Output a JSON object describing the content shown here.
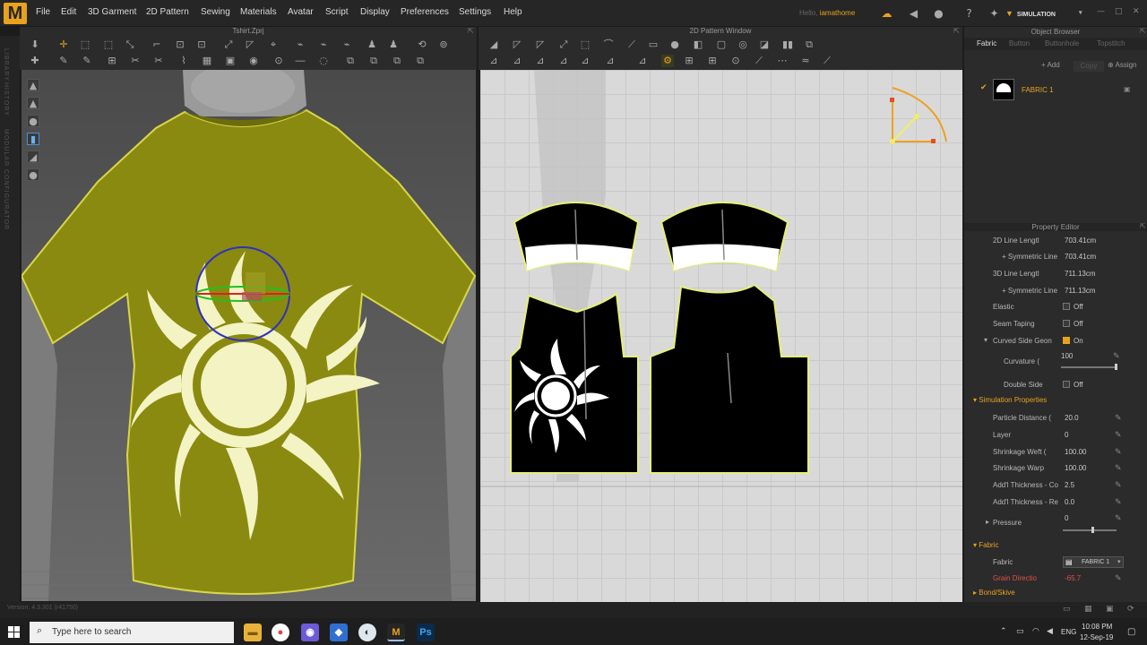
{
  "menubar": {
    "logo_text": "M",
    "items": [
      "File",
      "Edit",
      "3D Garment",
      "2D Pattern",
      "Sewing",
      "Materials",
      "Avatar",
      "Script",
      "Display",
      "Preferences",
      "Settings",
      "Help"
    ],
    "hello_label": "Hello,",
    "username": "iamathome",
    "mode": "SIMULATION"
  },
  "windows": {
    "left_title": "Tshirt.Zprj",
    "center_title": "2D Pattern Window"
  },
  "left_sidebar": {
    "tabs": [
      "LIBRARY",
      "HISTORY",
      "MODULAR CONFIGURATOR"
    ]
  },
  "object_browser": {
    "title": "Object Browser",
    "tabs": [
      "Fabric",
      "Button",
      "Buttonhole",
      "Topstitch"
    ],
    "actions": {
      "add": "+ Add",
      "copy": "Copy",
      "assign": "Assign"
    },
    "fabric_item": "FABRIC 1"
  },
  "property_editor": {
    "title": "Property Editor",
    "rows": [
      {
        "label": "2D Line Lengtl",
        "value": "703.41cm"
      },
      {
        "label": "+ Symmetric Line",
        "value": "703.41cm"
      },
      {
        "label": "3D Line Lengtl",
        "value": "711.13cm"
      },
      {
        "label": "+ Symmetric Line",
        "value": "711.13cm"
      },
      {
        "label": "Elastic",
        "value": "Off"
      },
      {
        "label": "Seam Taping",
        "value": "Off"
      },
      {
        "label": "Curved Side Geon",
        "value": "On"
      },
      {
        "label": "Curvature (",
        "value": "100"
      },
      {
        "label": "Double Side",
        "value": "Off"
      }
    ],
    "sim_section": "Simulation Properties",
    "sim_rows": [
      {
        "label": "Particle Distance (",
        "value": "20.0"
      },
      {
        "label": "Layer",
        "value": "0"
      },
      {
        "label": "Shrinkage Weft (",
        "value": "100.00"
      },
      {
        "label": "Shrinkage Warp",
        "value": "100.00"
      },
      {
        "label": "Add'l Thickness - Co",
        "value": "2.5"
      },
      {
        "label": "Add'l Thickness - Re",
        "value": "0.0"
      },
      {
        "label": "Pressure",
        "value": "0"
      }
    ],
    "fabric_section": "Fabric",
    "fabric_row": {
      "label": "Fabric",
      "value": "FABRIC 1"
    },
    "grain_row": {
      "label": "Grain Directio",
      "value": "-65.7"
    },
    "bond_section": "Bond/Skive"
  },
  "status": {
    "version": "Version: 4.3.301 (r41750)"
  },
  "taskbar": {
    "search_placeholder": "Type here to search",
    "time": "10:08 PM",
    "date": "12-Sep-19",
    "lang": "ENG"
  },
  "colors": {
    "accent": "#e8a21d",
    "shirt": "#8a8a10",
    "sun": "#f3f3c4",
    "pattern": "#000000"
  }
}
